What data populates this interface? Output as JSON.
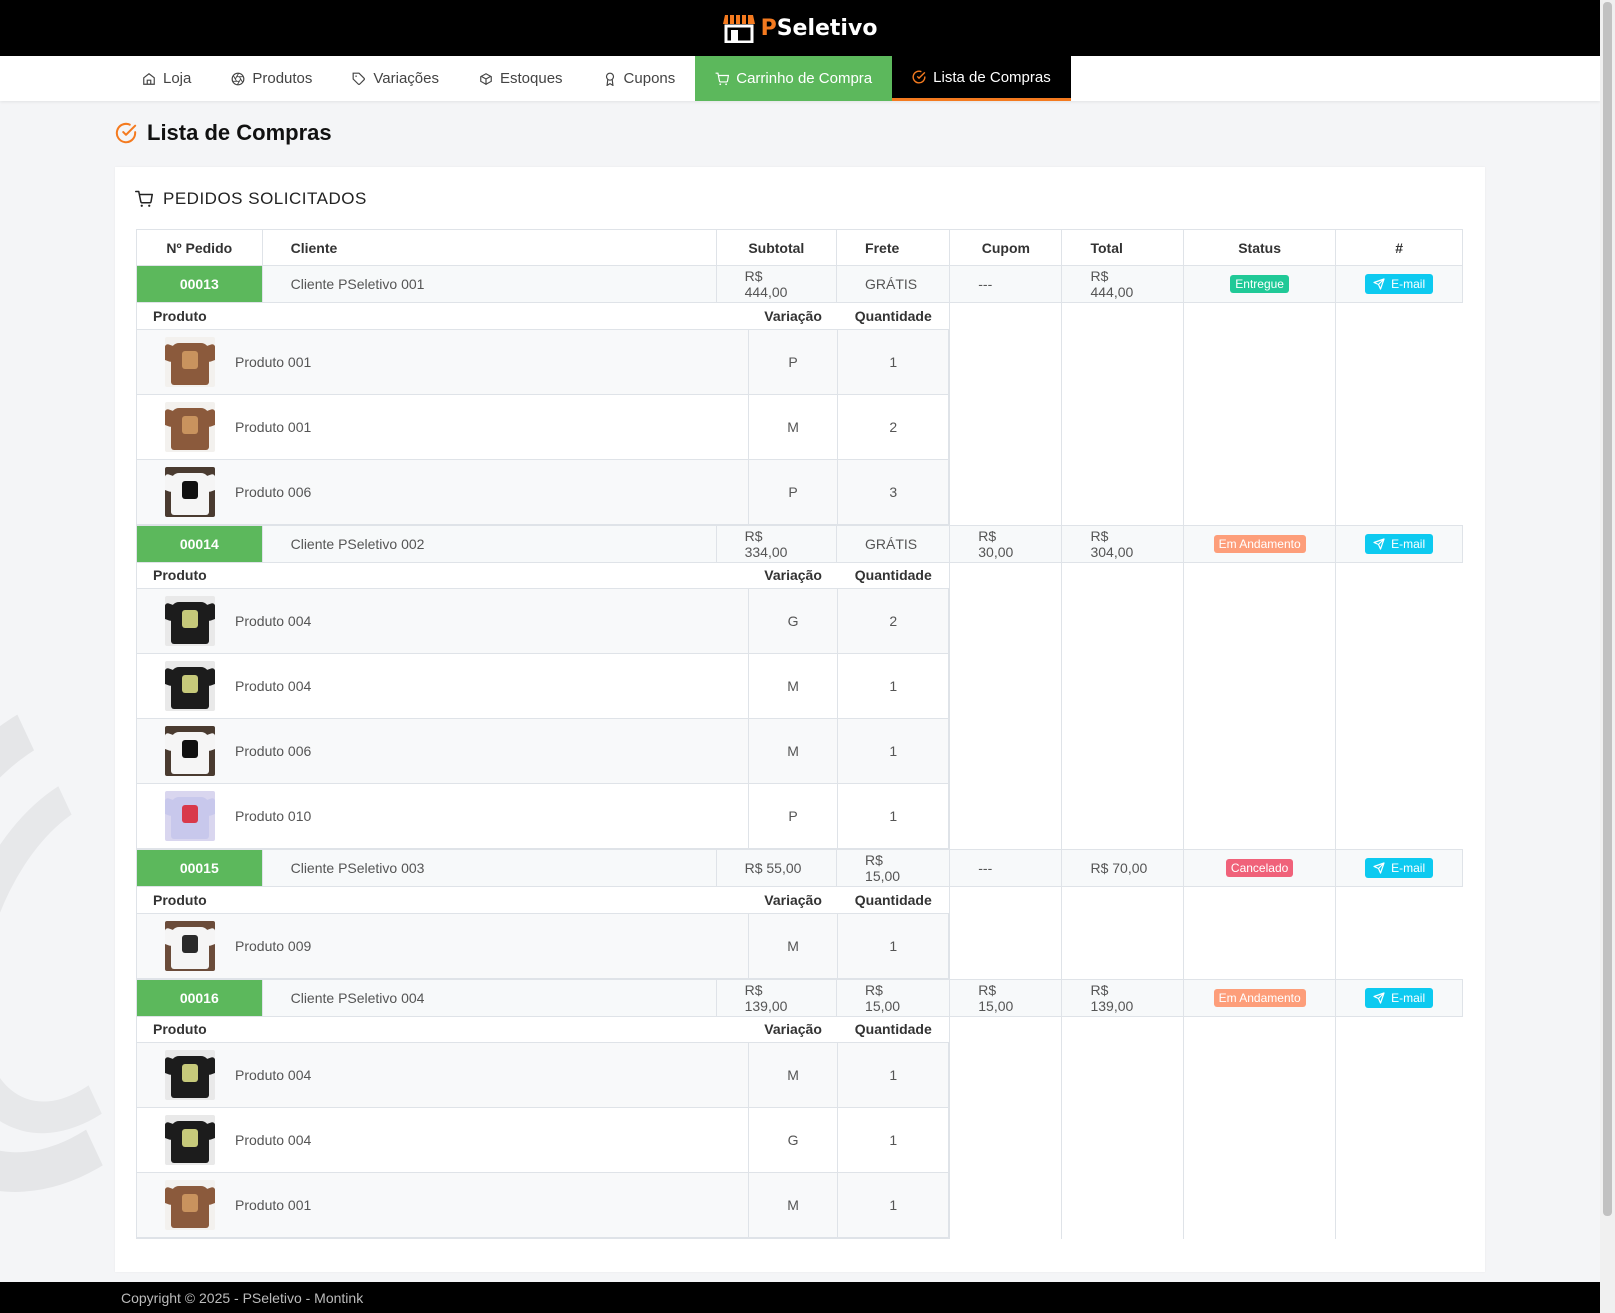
{
  "brand": {
    "prefix": "P",
    "name": "Seletivo"
  },
  "nav": [
    {
      "label": "Loja",
      "icon": "home-icon"
    },
    {
      "label": "Produtos",
      "icon": "aperture-icon"
    },
    {
      "label": "Variações",
      "icon": "tag-icon"
    },
    {
      "label": "Estoques",
      "icon": "box-icon"
    },
    {
      "label": "Cupons",
      "icon": "award-icon"
    },
    {
      "label": "Carrinho de Compra",
      "icon": "cart-icon"
    },
    {
      "label": "Lista de Compras",
      "icon": "check-circle-icon"
    }
  ],
  "page_title": "Lista de Compras",
  "card_title": "PEDIDOS SOLICITADOS",
  "columns": {
    "num": "Nº Pedido",
    "client": "Cliente",
    "subtotal": "Subtotal",
    "frete": "Frete",
    "cupom": "Cupom",
    "total": "Total",
    "status": "Status",
    "actions": "#"
  },
  "item_columns": {
    "product": "Produto",
    "variation": "Variação",
    "qty": "Quantidade"
  },
  "email_label": "E-mail",
  "colors": {
    "accent": "#f47a1f",
    "green": "#5cb85c",
    "entregue": "#20c997",
    "andamento": "#fd9e7a",
    "cancelado": "#f0627a",
    "info": "#0dcaf0"
  },
  "orders": [
    {
      "num": "00013",
      "client": "Cliente PSeletivo 001",
      "subtotal": "R$ 444,00",
      "frete": "GRÁTIS",
      "cupom": "---",
      "total": "R$ 444,00",
      "status": "Entregue",
      "status_color": "#20c997",
      "items": [
        {
          "product": "Produto 001",
          "variation": "P",
          "qty": "1",
          "img": "brown"
        },
        {
          "product": "Produto 001",
          "variation": "M",
          "qty": "2",
          "img": "brown"
        },
        {
          "product": "Produto 006",
          "variation": "P",
          "qty": "3",
          "img": "white-print"
        }
      ]
    },
    {
      "num": "00014",
      "client": "Cliente PSeletivo 002",
      "subtotal": "R$ 334,00",
      "frete": "GRÁTIS",
      "cupom": "R$ 30,00",
      "total": "R$ 304,00",
      "status": "Em Andamento",
      "status_color": "#fd9e7a",
      "items": [
        {
          "product": "Produto 004",
          "variation": "G",
          "qty": "2",
          "img": "black"
        },
        {
          "product": "Produto 004",
          "variation": "M",
          "qty": "1",
          "img": "black"
        },
        {
          "product": "Produto 006",
          "variation": "M",
          "qty": "1",
          "img": "white-print"
        },
        {
          "product": "Produto 010",
          "variation": "P",
          "qty": "1",
          "img": "lavender"
        }
      ]
    },
    {
      "num": "00015",
      "client": "Cliente PSeletivo 003",
      "subtotal": "R$ 55,00",
      "frete": "R$ 15,00",
      "cupom": "---",
      "total": "R$ 70,00",
      "status": "Cancelado",
      "status_color": "#f0627a",
      "items": [
        {
          "product": "Produto 009",
          "variation": "M",
          "qty": "1",
          "img": "white"
        }
      ]
    },
    {
      "num": "00016",
      "client": "Cliente PSeletivo 004",
      "subtotal": "R$ 139,00",
      "frete": "R$ 15,00",
      "cupom": "R$ 15,00",
      "total": "R$ 139,00",
      "status": "Em Andamento",
      "status_color": "#fd9e7a",
      "items": [
        {
          "product": "Produto 004",
          "variation": "M",
          "qty": "1",
          "img": "black"
        },
        {
          "product": "Produto 004",
          "variation": "G",
          "qty": "1",
          "img": "black"
        },
        {
          "product": "Produto 001",
          "variation": "M",
          "qty": "1",
          "img": "brown"
        }
      ]
    }
  ],
  "footer": "Copyright © 2025 - PSeletivo - Montink"
}
